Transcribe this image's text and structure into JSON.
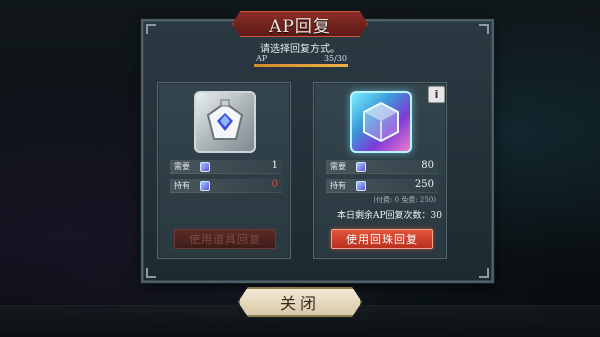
{
  "dialog": {
    "title": "AP回复",
    "subtitle": "请选择回复方式。",
    "ap_label": "AP",
    "ap_value": "35/30",
    "ap_fill_fraction": 1.0
  },
  "item_card": {
    "icon": "silver-bottle-icon",
    "need_label": "需要",
    "need_value": "1",
    "have_label": "持有",
    "have_value": "0",
    "button_label": "使用道具回复"
  },
  "gem_card": {
    "icon": "crystal-cube-icon",
    "info_label": "i",
    "need_label": "需要",
    "need_value": "80",
    "have_label": "持有",
    "have_value": "250",
    "note": "(付费: 0 免费: 250)",
    "remaining": "本日剩余AP回复次数：30",
    "button_label": "使用回珠回复"
  },
  "close_label": "关闭",
  "colors": {
    "accent_red": "#d8432e",
    "warning_red": "#e0463a",
    "ap_bar": "#e8a040"
  }
}
